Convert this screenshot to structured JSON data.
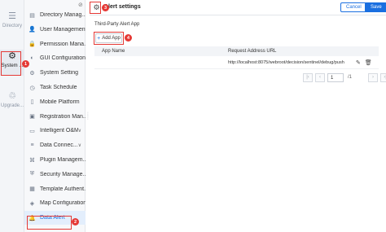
{
  "rail": {
    "items": [
      {
        "label": "Directory",
        "icon": "list-icon"
      },
      {
        "label": "System ...",
        "icon": "gear-icon"
      },
      {
        "label": "Upgrade...",
        "icon": "recycle-icon"
      }
    ]
  },
  "nav": {
    "items": [
      {
        "label": "Directory Manag...",
        "icon": "folder-icon",
        "chevron": ""
      },
      {
        "label": "User Management",
        "icon": "user-icon",
        "chevron": ""
      },
      {
        "label": "Permission Mana...",
        "icon": "lock-icon",
        "chevron": ""
      },
      {
        "label": "GUI Configuration",
        "icon": "palette-icon",
        "chevron": ""
      },
      {
        "label": "System Setting",
        "icon": "gear-icon",
        "chevron": ""
      },
      {
        "label": "Task Schedule",
        "icon": "clock-icon",
        "chevron": ""
      },
      {
        "label": "Mobile Platform",
        "icon": "mobile-icon",
        "chevron": ""
      },
      {
        "label": "Registration Man...",
        "icon": "registration-icon",
        "chevron": ""
      },
      {
        "label": "Intelligent O&M",
        "icon": "monitor-icon",
        "chevron": "∨"
      },
      {
        "label": "Data Connec...",
        "icon": "database-icon",
        "chevron": "∨"
      },
      {
        "label": "Plugin Managem...",
        "icon": "plugin-icon",
        "chevron": ""
      },
      {
        "label": "Security Manage...",
        "icon": "shield-icon",
        "chevron": ""
      },
      {
        "label": "Template Authent...",
        "icon": "template-icon",
        "chevron": ""
      },
      {
        "label": "Map Configuration",
        "icon": "map-icon",
        "chevron": ""
      },
      {
        "label": "Data Alert",
        "icon": "bell-icon",
        "chevron": ""
      }
    ]
  },
  "topbar": {
    "title": "Alert settings",
    "cancel_label": "Cancel",
    "save_label": "Save"
  },
  "main": {
    "subheading": "Third-Party Alert App",
    "add_button_label": "Add App",
    "table": {
      "columns": [
        "App Name",
        "Request Address URL"
      ],
      "rows": [
        {
          "app_name": "",
          "url": "http://localhost:8075/webroot/decision/sentinel/debug/push"
        }
      ]
    },
    "pagination": {
      "current_page": "1",
      "total": "/1"
    }
  },
  "annotations": [
    "1",
    "2",
    "3",
    "4"
  ],
  "colors": {
    "accent": "#1a6fe0",
    "annotation": "#e53935",
    "active_nav_bg": "#e3eefc"
  }
}
